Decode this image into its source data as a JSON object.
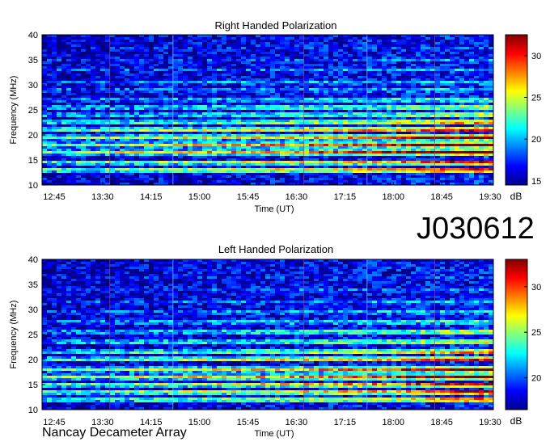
{
  "observation_id": "J030612",
  "credit": "Nancay Decameter Array",
  "chart_data": [
    {
      "type": "heatmap",
      "title": "Right Handed Polarization",
      "xlabel": "Time (UT)",
      "ylabel": "Frequency (MHz)",
      "x_ticks": [
        "12:45",
        "13:30",
        "14:15",
        "15:00",
        "15:45",
        "16:30",
        "17:15",
        "18:00",
        "18:45",
        "19:30"
      ],
      "y_ticks": [
        10,
        15,
        20,
        25,
        30,
        35,
        40
      ],
      "ylim": [
        10,
        40
      ],
      "colorbar": {
        "label": "dB",
        "ticks": [
          15,
          20,
          25,
          30
        ],
        "range": [
          14.5,
          32.5
        ]
      },
      "bright_bands_mhz": [
        {
          "freq": 13.0,
          "level": 0.85
        },
        {
          "freq": 14.5,
          "level": 0.8
        },
        {
          "freq": 16.5,
          "level": 0.95
        },
        {
          "freq": 18.0,
          "level": 0.9
        },
        {
          "freq": 19.5,
          "level": 0.9
        },
        {
          "freq": 21.0,
          "level": 0.85
        },
        {
          "freq": 22.5,
          "level": 0.7
        },
        {
          "freq": 24.0,
          "level": 0.55
        },
        {
          "freq": 25.5,
          "level": 0.55
        },
        {
          "freq": 27.0,
          "level": 0.45
        },
        {
          "freq": 29.0,
          "level": 0.35
        },
        {
          "freq": 30.5,
          "level": 0.35
        },
        {
          "freq": 33.0,
          "level": 0.3
        },
        {
          "freq": 35.0,
          "level": 0.25
        },
        {
          "freq": 37.5,
          "level": 0.2
        }
      ]
    },
    {
      "type": "heatmap",
      "title": "Left Handed Polarization",
      "xlabel": "Time (UT)",
      "ylabel": "Frequency (MHz)",
      "x_ticks": [
        "12:45",
        "13:30",
        "14:15",
        "15:00",
        "15:45",
        "16:30",
        "17:15",
        "18:00",
        "18:45",
        "19:30"
      ],
      "y_ticks": [
        10,
        15,
        20,
        25,
        30,
        35,
        40
      ],
      "ylim": [
        10,
        40
      ],
      "colorbar": {
        "label": "dB",
        "ticks": [
          20,
          25,
          30
        ],
        "range": [
          16.5,
          33
        ]
      },
      "bright_bands_mhz": [
        {
          "freq": 12.0,
          "level": 0.75
        },
        {
          "freq": 13.5,
          "level": 0.85
        },
        {
          "freq": 15.0,
          "level": 0.85
        },
        {
          "freq": 16.5,
          "level": 0.9
        },
        {
          "freq": 18.0,
          "level": 0.85
        },
        {
          "freq": 20.0,
          "level": 0.8
        },
        {
          "freq": 21.5,
          "level": 0.7
        },
        {
          "freq": 23.5,
          "level": 0.6
        },
        {
          "freq": 25.5,
          "level": 0.55
        },
        {
          "freq": 27.5,
          "level": 0.45
        },
        {
          "freq": 29.5,
          "level": 0.35
        },
        {
          "freq": 31.5,
          "level": 0.3
        },
        {
          "freq": 34.0,
          "level": 0.25
        },
        {
          "freq": 36.5,
          "level": 0.2
        }
      ]
    }
  ]
}
